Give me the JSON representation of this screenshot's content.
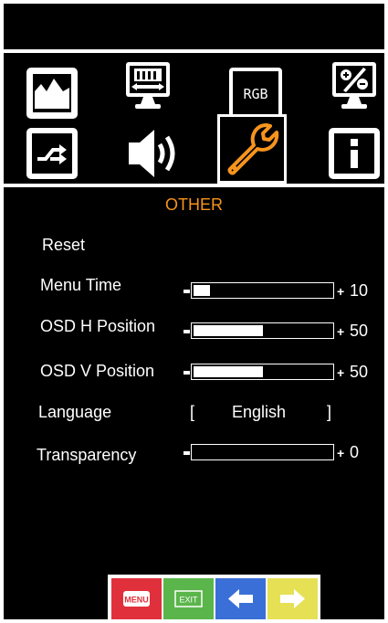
{
  "menu": {
    "section_title": "OTHER",
    "icons": [
      {
        "name": "picture-icon"
      },
      {
        "name": "display-position-icon"
      },
      {
        "name": "rgb-color-icon",
        "label": "RGB"
      },
      {
        "name": "percent-ratio-icon"
      },
      {
        "name": "input-source-icon"
      },
      {
        "name": "audio-icon"
      },
      {
        "name": "other-settings-icon",
        "selected": true
      },
      {
        "name": "information-icon"
      }
    ],
    "accent_color": "#f7941d"
  },
  "settings": {
    "reset": {
      "label": "Reset"
    },
    "menu_time": {
      "label": "Menu Time",
      "value": "10",
      "fraction": 0.12
    },
    "osd_h_position": {
      "label": "OSD H Position",
      "value": "50",
      "fraction": 0.5
    },
    "osd_v_position": {
      "label": "OSD V Position",
      "value": "50",
      "fraction": 0.5
    },
    "language": {
      "label": "Language",
      "open_bracket": "[",
      "value": "English",
      "close_bracket": "]"
    },
    "transparency": {
      "label": "Transparency",
      "value": "0",
      "fraction": 0.0
    }
  },
  "buttons": {
    "menu": {
      "label": "MENU",
      "color": "#e0303c"
    },
    "exit": {
      "label": "EXIT",
      "color": "#5ab54a"
    },
    "left": {
      "color": "#3b6fd8"
    },
    "right": {
      "color": "#e6e055"
    }
  }
}
